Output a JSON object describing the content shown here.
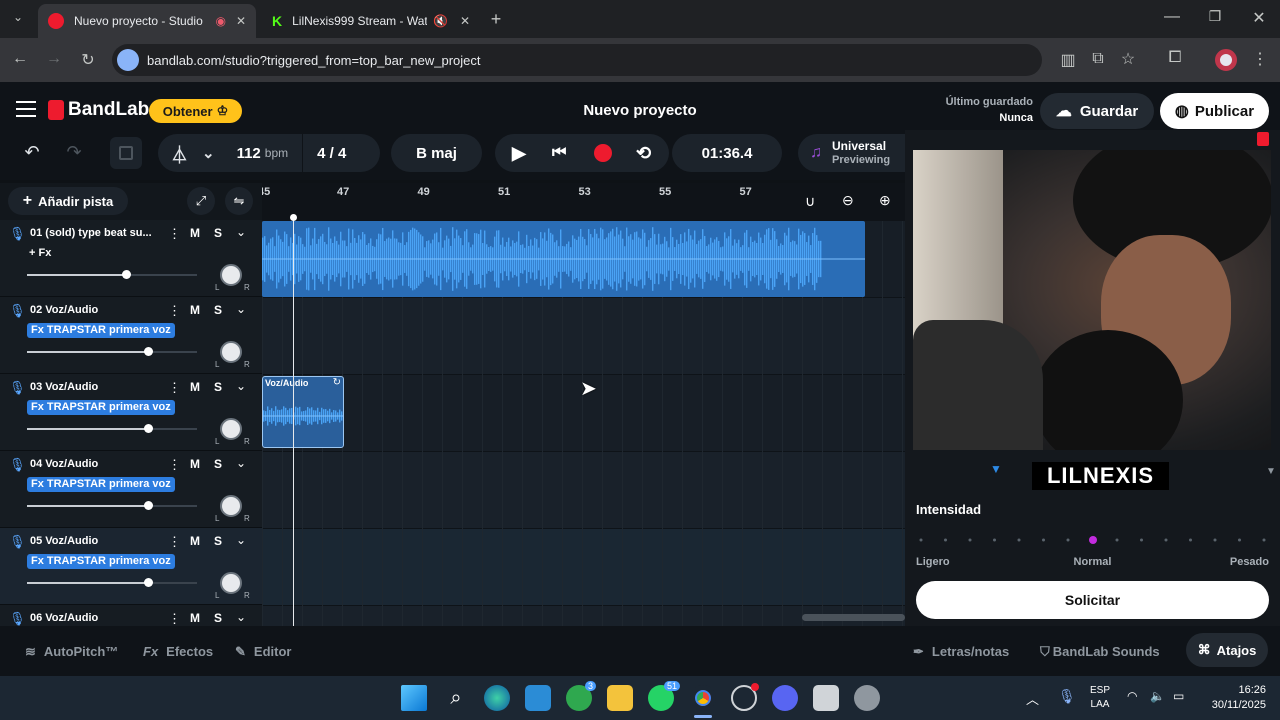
{
  "browser": {
    "tabs": [
      {
        "label": "Nuevo proyecto - Studio",
        "active": true
      },
      {
        "label": "LilNexis999 Stream - Watch",
        "active": false
      }
    ],
    "url": "bandlab.com/studio?triggered_from=top_bar_new_project"
  },
  "app": {
    "brand": "BandLab",
    "get_label": "Obtener",
    "project_title": "Nuevo proyecto",
    "last_saved_label": "Último guardado",
    "last_saved_value": "Nunca",
    "save_label": "Guardar",
    "publish_label": "Publicar"
  },
  "transport": {
    "bpm_value": "112",
    "bpm_unit": "bpm",
    "time_sig": "4 / 4",
    "key": "B maj",
    "time": "01:36.4",
    "preset_title": "Universal",
    "preset_sub": "Previewing"
  },
  "tracks_panel": {
    "add_track_label": "Añadir pista",
    "mute_label": "M",
    "solo_label": "S",
    "tracks": [
      {
        "name": "01  (sold) type beat su...",
        "fx": "+ Fx",
        "volume": 0.58
      },
      {
        "name": "02  Voz/Audio",
        "fx": "Fx TRAPSTAR primera voz",
        "volume": 0.71
      },
      {
        "name": "03  Voz/Audio",
        "fx": "Fx TRAPSTAR primera voz",
        "volume": 0.71
      },
      {
        "name": "04  Voz/Audio",
        "fx": "Fx TRAPSTAR primera voz",
        "volume": 0.71
      },
      {
        "name": "05  Voz/Audio",
        "fx": "Fx TRAPSTAR primera voz",
        "volume": 0.71
      },
      {
        "name": "06  Voz/Audio",
        "fx": "",
        "volume": 0.71
      }
    ]
  },
  "timeline": {
    "ruler_marks": [
      "45",
      "47",
      "49",
      "51",
      "53",
      "55",
      "57"
    ],
    "clip_label": "Voz/Audio"
  },
  "right_panel": {
    "overlay_name": "LILNEXIS",
    "intensity_label": "Intensidad",
    "scale_labels": [
      "Ligero",
      "Normal",
      "Pesado"
    ],
    "intensity_value": "Normal",
    "request_label": "Solicitar"
  },
  "bottom_bar": {
    "autopitch": "AutoPitch™",
    "effects": "Efectos",
    "editor": "Editor",
    "lyrics": "Letras/notas",
    "sounds": "BandLab Sounds",
    "shortcuts": "Atajos"
  },
  "taskbar": {
    "lang_top": "ESP",
    "lang_bottom": "LAA",
    "time": "16:26",
    "date": "30/11/2025",
    "xbox_badge": "3",
    "whatsapp_badge": "51"
  },
  "colors": {
    "accent_blue": "#2d8ae6",
    "waveform": "#3b95ea",
    "record_red": "#ee1b2e",
    "get_yellow": "#ffc21a",
    "intensity_purple": "#c22bde"
  }
}
